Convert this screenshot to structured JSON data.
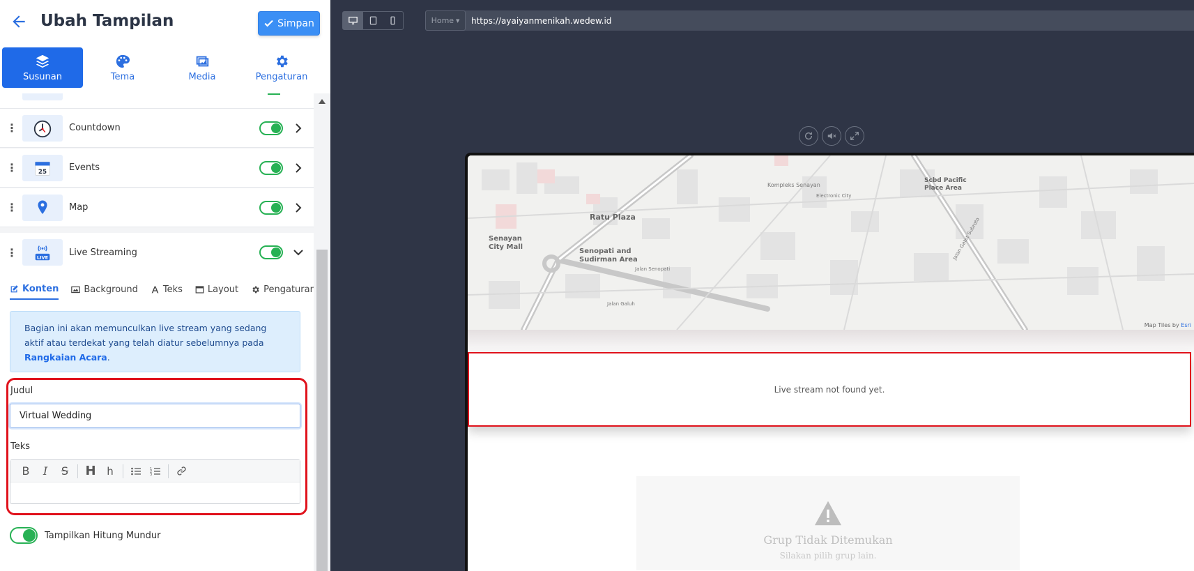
{
  "header": {
    "title": "Ubah Tampilan",
    "save_label": "Simpan"
  },
  "main_tabs": [
    {
      "label": "Susunan",
      "icon": "layers-icon",
      "active": true
    },
    {
      "label": "Tema",
      "icon": "palette-icon",
      "active": false
    },
    {
      "label": "Media",
      "icon": "images-icon",
      "active": false
    },
    {
      "label": "Pengaturan",
      "icon": "gear-icon",
      "active": false
    }
  ],
  "sections": [
    {
      "label": "Countdown",
      "icon": "clock-icon",
      "enabled": true
    },
    {
      "label": "Events",
      "icon": "calendar-icon",
      "icon_text": "25",
      "enabled": true
    },
    {
      "label": "Map",
      "icon": "map-pin-icon",
      "enabled": true
    },
    {
      "label": "Live Streaming",
      "icon": "live-icon",
      "icon_text": "LIVE",
      "enabled": true,
      "expanded": true
    }
  ],
  "sub_tabs": [
    {
      "label": "Konten",
      "icon": "edit-icon",
      "active": true
    },
    {
      "label": "Background",
      "icon": "image-icon"
    },
    {
      "label": "Teks",
      "icon": "font-icon"
    },
    {
      "label": "Layout",
      "icon": "window-icon"
    },
    {
      "label": "Pengaturan",
      "icon": "gear-icon"
    }
  ],
  "info": {
    "text_before": "Bagian ini akan memunculkan live stream yang sedang aktif atau terdekat yang telah diatur sebelumnya pada ",
    "link": "Rangkaian Acara",
    "text_after": "."
  },
  "form": {
    "judul_label": "Judul",
    "judul_value": "Virtual Wedding",
    "teks_label": "Teks",
    "countdown_label": "Tampilkan Hitung Mundur",
    "countdown_enabled": true
  },
  "preview": {
    "page_select": "Home",
    "url": "https://ayaiyanmenikah.wedew.id",
    "map_attribution_prefix": "Map Tiles by ",
    "map_attribution_link": "Esri",
    "map_labels": [
      "Ratu Plaza",
      "Senopati and Sudirman Area",
      "Senayan City Mall",
      "Scbd Pacific Place Area",
      "Kompleks Senayan",
      "Electronic City",
      "Jalan Senopati",
      "Jalan Gatot Subroto",
      "Jalan Galuh"
    ],
    "live_message": "Live stream not found yet.",
    "group_title": "Grup Tidak Ditemukan",
    "group_subtitle": "Silakan pilih grup lain."
  },
  "colors": {
    "primary": "#1f6ae8",
    "toggle_on": "#27b154",
    "highlight": "#e0121c"
  }
}
